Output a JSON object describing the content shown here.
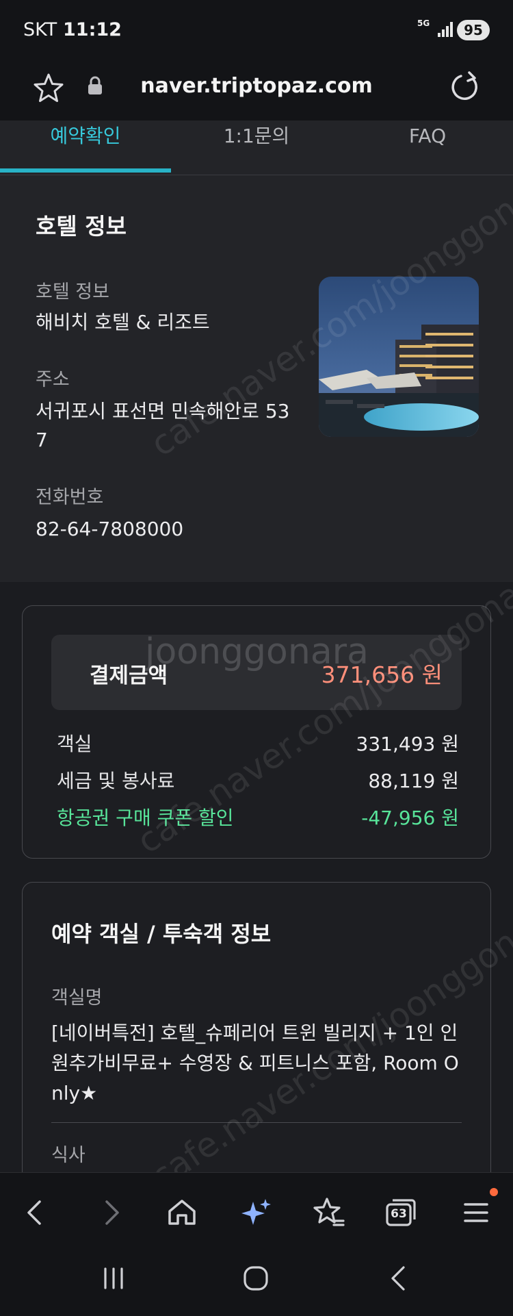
{
  "status_bar": {
    "carrier": "SKT",
    "time": "11:12",
    "network": "5G",
    "battery": "95"
  },
  "browser": {
    "url": "naver.triptopaz.com"
  },
  "tabs": [
    {
      "label": "예약확인",
      "active": true
    },
    {
      "label": "1:1문의",
      "active": false
    },
    {
      "label": "FAQ",
      "active": false
    }
  ],
  "hotel": {
    "title": "호텔 정보",
    "name_label": "호텔 정보",
    "name": "해비치 호텔 & 리조트",
    "address_label": "주소",
    "address_line1": "서귀포시 표선면 민속해안로 53",
    "address_line2": "7",
    "phone_label": "전화번호",
    "phone": "82-64-7808000"
  },
  "payment": {
    "total_label": "결제금액",
    "total_value": "371,656 원",
    "rows": [
      {
        "label": "객실",
        "value": "331,493 원"
      },
      {
        "label": "세금 및 봉사료",
        "value": "88,119 원"
      },
      {
        "label": "항공권 구매 쿠폰 할인",
        "value": "-47,956 원"
      }
    ]
  },
  "room": {
    "title": "예약 객실 / 투숙객 정보",
    "room_label": "객실명",
    "room_name": "[네이버특전] 호텔_슈페리어 트윈 빌리지 + 1인 인원추가비무료+ 수영장 & 피트니스 포함, Room Only★",
    "meal_label": "식사"
  },
  "bottom_nav": {
    "tabs_count": "63"
  },
  "watermark": {
    "text_1": "cafe.naver.com/joonggonara",
    "text_2": "joonggonara"
  },
  "colors": {
    "accent": "#37c9db",
    "total_price": "#ff8f7a",
    "discount": "#58e59a",
    "background": "#1b1c20"
  }
}
